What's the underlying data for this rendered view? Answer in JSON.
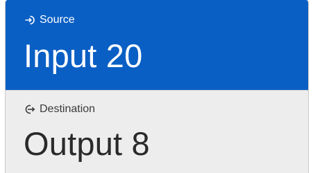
{
  "source": {
    "label": "Source",
    "value": "Input 20",
    "icon": "source-arrow-in-icon",
    "background_color": "#0a5fc4"
  },
  "destination": {
    "label": "Destination",
    "value": "Output 8",
    "icon": "destination-arrow-out-icon",
    "background_color": "#ededed"
  }
}
